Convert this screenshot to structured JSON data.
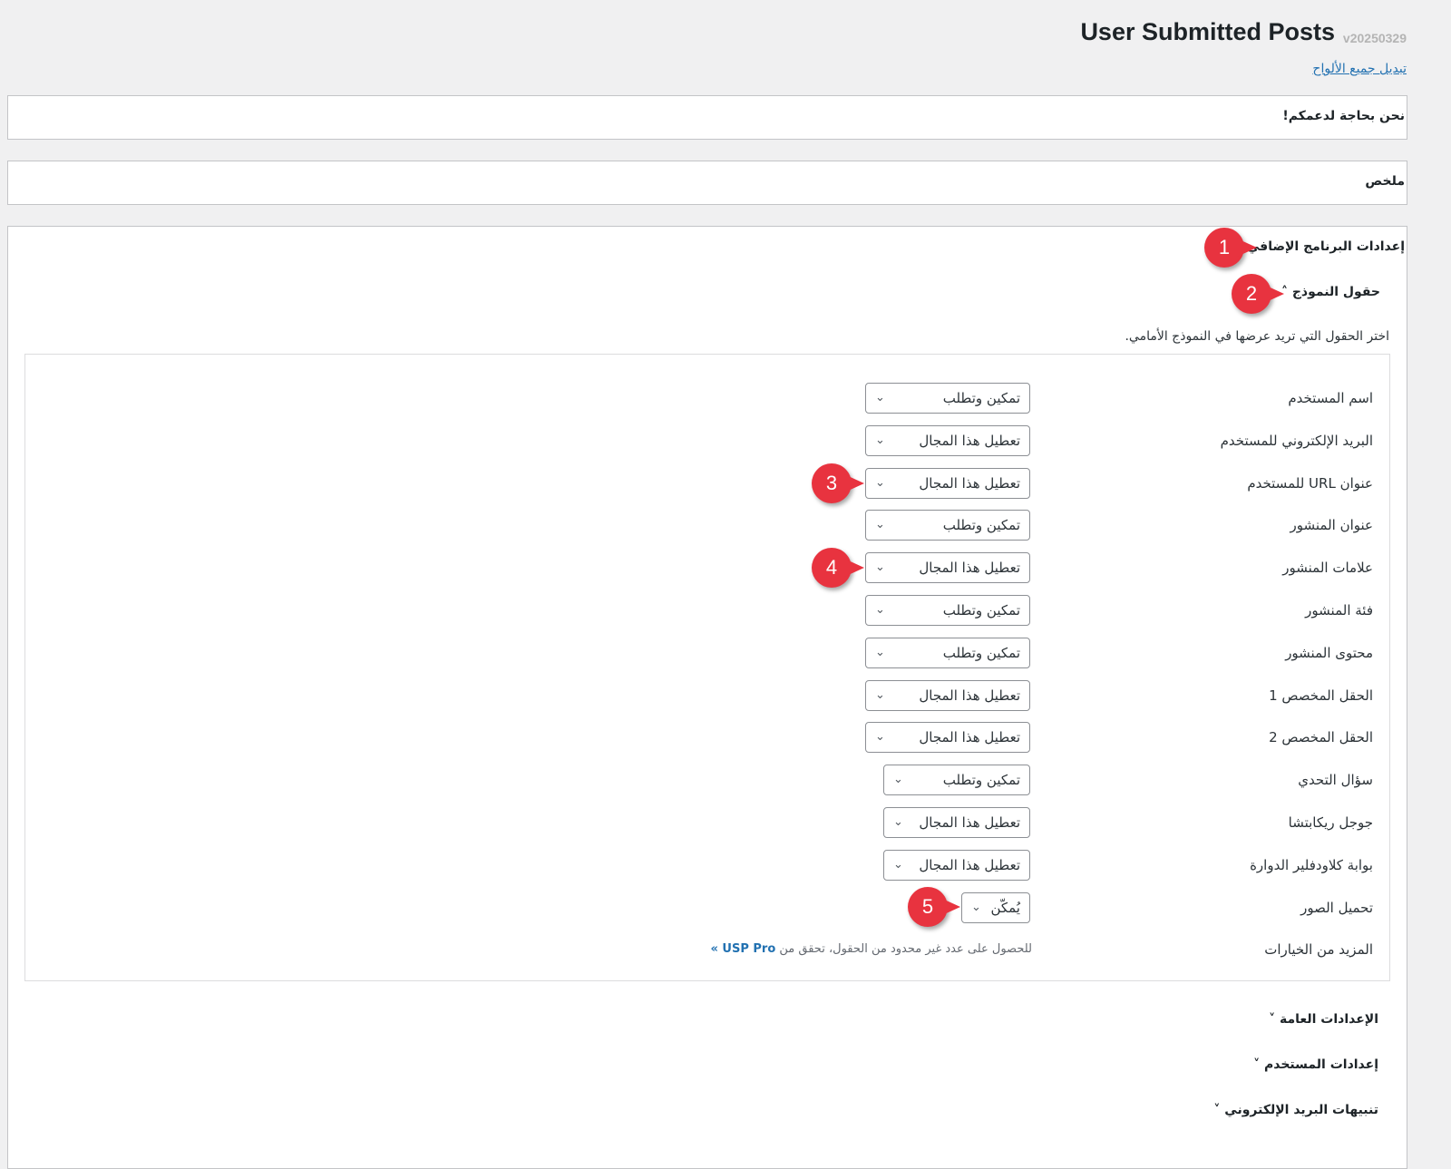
{
  "header": {
    "title": "User Submitted Posts",
    "version": "v20250329",
    "toggle_link": "تبديل جميع الألواح"
  },
  "panels": {
    "support": "نحن بحاجة لدعمكم!",
    "summary": "ملخص",
    "plugin_settings": "إعدادات البرنامج الإضافي"
  },
  "form_fields": {
    "heading": "حقول النموذج",
    "description": "اختر الحقول التي تريد عرضها في النموذج الأمامي.",
    "rows": [
      {
        "label": "اسم المستخدم",
        "value": "تمكين وتطلب"
      },
      {
        "label": "البريد الإلكتروني للمستخدم",
        "value": "تعطيل هذا المجال"
      },
      {
        "label": "عنوان URL للمستخدم",
        "value": "تعطيل هذا المجال"
      },
      {
        "label": "عنوان المنشور",
        "value": "تمكين وتطلب"
      },
      {
        "label": "علامات المنشور",
        "value": "تعطيل هذا المجال"
      },
      {
        "label": "فئة المنشور",
        "value": "تمكين وتطلب"
      },
      {
        "label": "محتوى المنشور",
        "value": "تمكين وتطلب"
      },
      {
        "label": "الحقل المخصص 1",
        "value": "تعطيل هذا المجال"
      },
      {
        "label": "الحقل المخصص 2",
        "value": "تعطيل هذا المجال"
      },
      {
        "label": "سؤال التحدي",
        "value": "تمكين وتطلب"
      },
      {
        "label": "جوجل ريكابتشا",
        "value": "تعطيل هذا المجال"
      },
      {
        "label": "بوابة كلاودفلير الدوارة",
        "value": "تعطيل هذا المجال"
      },
      {
        "label": "تحميل الصور",
        "value": "يُمكّن"
      }
    ],
    "more_label": "المزيد من الخيارات",
    "more_text": "للحصول على عدد غير محدود من الحقول، تحقق من",
    "more_link": "USP Pro »"
  },
  "sections": [
    "الإعدادات العامة",
    "إعدادات المستخدم",
    "تنبيهات البريد الإلكتروني"
  ],
  "callouts": [
    "1",
    "2",
    "3",
    "4",
    "5"
  ],
  "colors": {
    "callout": "#e8333f",
    "link": "#2271b1"
  }
}
